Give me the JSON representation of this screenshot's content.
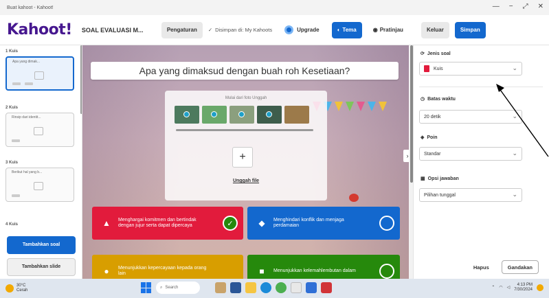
{
  "window": {
    "title": "Buat kahoot - Kahoot!",
    "controls": [
      "—",
      "−",
      "⤢",
      "✕"
    ]
  },
  "header": {
    "logo": "Kahoot!",
    "quiz_name": "SOAL EVALUASI M...",
    "settings_label": "Pengaturan",
    "saved_label": "Disimpan di: My Kahoots",
    "upgrade_label": "Upgrade",
    "themes_label": "Tema",
    "preview_label": "Pratinjau",
    "exit_label": "Keluar",
    "save_label": "Simpan"
  },
  "sidebar": {
    "slides": [
      {
        "num": "1  Kuis",
        "text": "Apa yang dimak..."
      },
      {
        "num": "2  Kuis",
        "text": "Rinsip dari identit..."
      },
      {
        "num": "3  Kuis",
        "text": "Berikut hal yang b..."
      },
      {
        "num": "4  Kuis",
        "text": ""
      }
    ],
    "add_question_label": "Tambahkan soal",
    "add_slide_label": "Tambahkan slide"
  },
  "editor": {
    "question": "Apa yang dimaksud dengan buah roh Kesetiaan?",
    "media_header": "Mulai dari foto Unggah",
    "upload_label": "Unggah file",
    "answers": [
      {
        "text": "Menghargai komitmen dan bertindak dengan jujur serta dapat dipercaya",
        "shape": "triangle",
        "correct": true,
        "color": "#e21b3c"
      },
      {
        "text": "Menghindari konflik dan menjaga perdamaian",
        "shape": "diamond",
        "correct": false,
        "color": "#1368ce"
      },
      {
        "text": "Menunjukkan kepercayaan kepada orang lain",
        "shape": "circle",
        "correct": false,
        "color": "#d89e00"
      },
      {
        "text": "Menunjukkan kelemahlembutan dalam",
        "shape": "square",
        "correct": false,
        "color": "#26890c"
      }
    ]
  },
  "right_panel": {
    "question_type_label": "Jenis soal",
    "question_type_value": "Kuis",
    "time_limit_label": "Batas waktu",
    "time_limit_value": "20 detik",
    "points_label": "Poin",
    "points_value": "Standar",
    "answer_options_label": "Opsi jawaban",
    "answer_options_value": "Pilihan tunggal",
    "delete_label": "Hapus",
    "duplicate_label": "Gandakan"
  },
  "taskbar": {
    "weather_temp": "30°C",
    "weather_desc": "Cerah",
    "search_placeholder": "Search",
    "time": "4:13 PM",
    "date": "7/30/2024"
  }
}
